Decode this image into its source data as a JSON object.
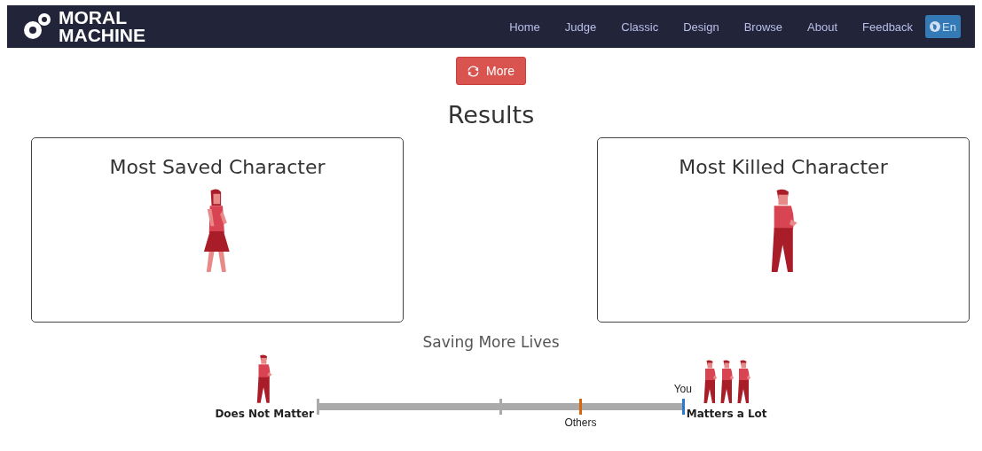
{
  "nav": {
    "logo": [
      "MORAL",
      "MACHINE"
    ],
    "links": [
      {
        "label": "Home"
      },
      {
        "label": "Judge"
      },
      {
        "label": "Classic"
      },
      {
        "label": "Design"
      },
      {
        "label": "Browse"
      },
      {
        "label": "About"
      },
      {
        "label": "Feedback"
      }
    ],
    "language": "En"
  },
  "more_button": "More",
  "title": "Results",
  "cards": [
    {
      "title": "Most Saved Character",
      "kind": "woman"
    },
    {
      "title": "Most Killed Character",
      "kind": "man"
    }
  ],
  "scale": {
    "title": "Saving More Lives",
    "left_label": "Does Not Matter",
    "right_label": "Matters a Lot",
    "markers": [
      {
        "label": "Others",
        "level": 0.72,
        "color": "#d9660c",
        "kind": "below"
      },
      {
        "label": "You",
        "level": 1,
        "color": "#2a7bd0",
        "kind": "above"
      }
    ]
  }
}
